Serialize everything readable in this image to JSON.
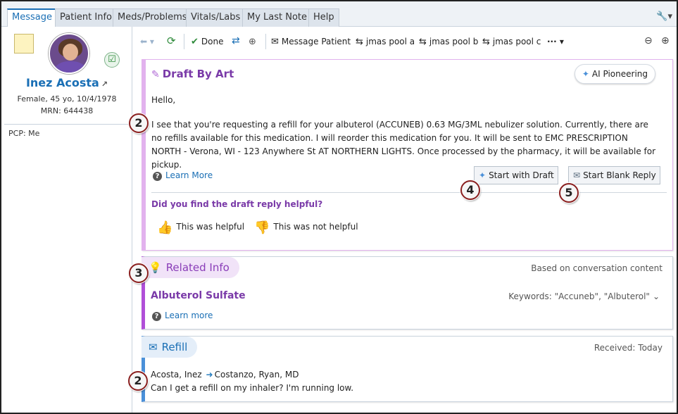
{
  "tabs": [
    "Message",
    "Patient Info",
    "Meds/Problems",
    "Vitals/Labs",
    "My Last Note",
    "Help"
  ],
  "patient": {
    "name": "Inez Acosta",
    "demographics": "Female, 45 yo, 10/4/1978",
    "mrn": "MRN: 644438",
    "pcp": "PCP: Me"
  },
  "toolbar": {
    "done": "Done",
    "message_patient": "Message Patient",
    "pool_a": "jmas pool a",
    "pool_b": "jmas pool b",
    "pool_c": "jmas pool c",
    "more": "···"
  },
  "draft": {
    "title": "Draft By Art",
    "badge": "AI Pioneering",
    "greeting": "Hello,",
    "body": "I see that you're requesting a refill for your albuterol (ACCUNEB) 0.63 MG/3ML nebulizer solution. Currently, there are no refills available for this medication. I will reorder this medication for you. It will be sent to EMC PRESCRIPTION NORTH - Verona, WI - 123 Anywhere St AT NORTHERN LIGHTS. Once processed by the pharmacy, it will be available for pickup.",
    "learn_more": "Learn More",
    "start_with_draft": "Start with Draft",
    "start_blank_reply": "Start Blank Reply",
    "feedback_question": "Did you find the draft reply helpful?",
    "helpful": "This was helpful",
    "not_helpful": "This was not helpful"
  },
  "related": {
    "title": "Related Info",
    "note": "Based on conversation content",
    "item": "Albuterol Sulfate",
    "keywords": "Keywords: \"Accuneb\", \"Albuterol\"",
    "learn_more": "Learn more"
  },
  "refill": {
    "title": "Refill",
    "received": "Received: Today",
    "from": "Acosta, Inez",
    "to": "Costanzo, Ryan, MD",
    "message": "Can I get a refill on my inhaler? I'm running low."
  },
  "callouts": [
    "2",
    "2",
    "3",
    "4",
    "5"
  ],
  "colors": {
    "accent_blue": "#1a6fb5",
    "draft_purple": "#7a3aa8",
    "related_border": "#b04fd8",
    "refill_border": "#4a90d9"
  }
}
